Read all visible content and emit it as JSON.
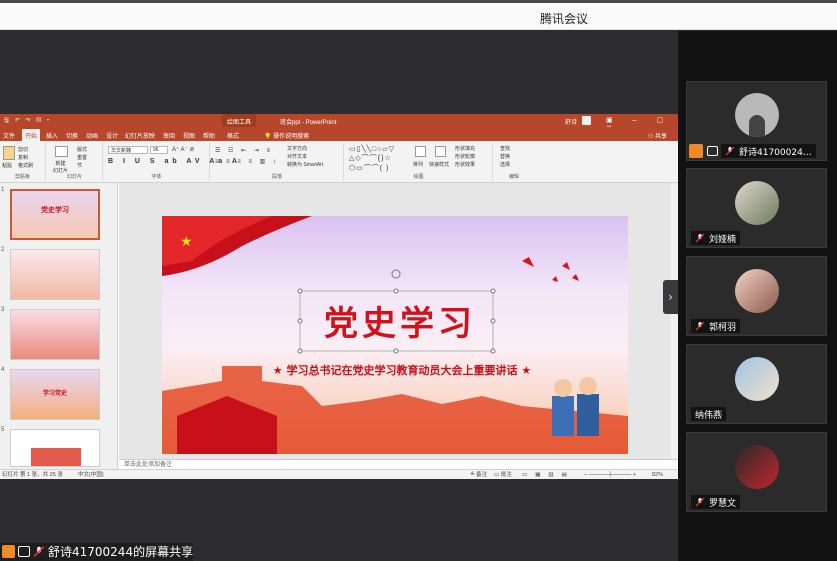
{
  "meeting": {
    "title": "腾讯会议",
    "sharer_label": "舒诗41700244的屏幕共享"
  },
  "ppt": {
    "drawing_tools": "绘图工具",
    "doc_title": "班会ppt  -  PowerPoint",
    "user": "舒诗",
    "tabs": [
      "文件",
      "开始",
      "插入",
      "切换",
      "动画",
      "设计",
      "幻灯片放映",
      "审阅",
      "视图",
      "帮助",
      "格式"
    ],
    "active_tab": "开始",
    "tell_me": "操作说明搜索",
    "share": "共享",
    "ribbon": {
      "paste": "粘贴",
      "cut": "剪切",
      "copy": "复制",
      "format_painter": "格式刷",
      "clipboard": "剪贴板",
      "new_slide": "新建\n幻灯片",
      "layout": "版式",
      "reset": "重置",
      "section": "节",
      "slides": "幻灯片",
      "font_name": "华文新魏",
      "font_size": "96",
      "font": "字体",
      "text_direction": "文字方向",
      "align_text": "对齐文本",
      "smartart": "转换为 SmartArt",
      "paragraph": "段落",
      "arrange": "排列",
      "quick_styles": "快速样式",
      "shape_fill": "形状填充",
      "shape_outline": "形状轮廓",
      "shape_effects": "形状效果",
      "drawing": "绘图",
      "find": "查找",
      "replace": "替换",
      "select": "选择",
      "editing": "编辑"
    },
    "thumbnails": [
      {
        "num": "1",
        "title": "党史学习"
      },
      {
        "num": "2",
        "title": ""
      },
      {
        "num": "3",
        "title": ""
      },
      {
        "num": "4",
        "title": "学习党史"
      },
      {
        "num": "5",
        "title": ""
      }
    ],
    "notes_placeholder": "单击此处添加备注",
    "status": {
      "slide_info": "幻灯片 第 1 张，共 25 张",
      "language": "中文(中国)",
      "notes": "备注",
      "comments": "批注",
      "zoom": "82%"
    },
    "slide": {
      "title": "党史学习",
      "subtitle": "学习总书记在党史学习教育动员大会上重要讲话",
      "star": "★"
    }
  },
  "participants": [
    {
      "name": "舒诗41700024…",
      "host": true
    },
    {
      "name": "刘娅楠"
    },
    {
      "name": "郭柯羽"
    },
    {
      "name": "纳伟燕"
    },
    {
      "name": "罗慧文"
    }
  ],
  "colors": {
    "ppt_red": "#b7472a",
    "slide_red": "#d5101a",
    "host_orange": "#f08a24"
  }
}
